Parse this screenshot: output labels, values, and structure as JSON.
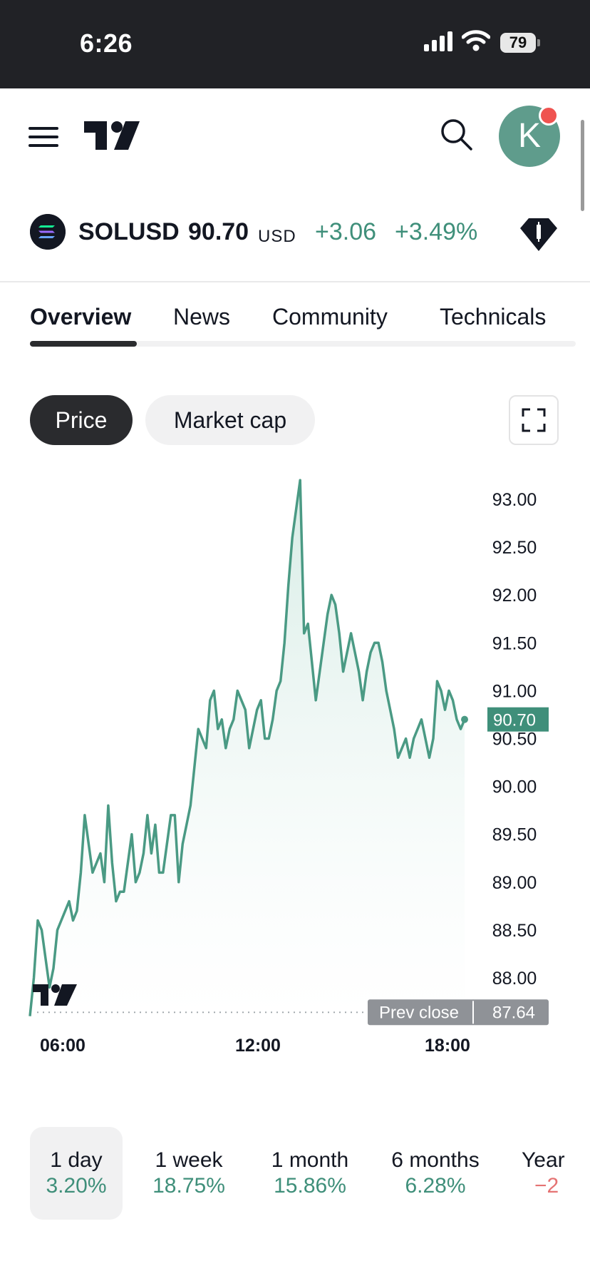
{
  "status_bar": {
    "time": "6:26",
    "battery": "79"
  },
  "header": {
    "avatar_letter": "K",
    "has_notification": true
  },
  "ticker": {
    "symbol": "SOLUSD",
    "price": "90.70",
    "currency": "USD",
    "change": "+3.06",
    "change_percent": "+3.49%",
    "change_color": "#3f8f7a"
  },
  "tabs": [
    {
      "label": "Overview",
      "active": true
    },
    {
      "label": "News",
      "active": false
    },
    {
      "label": "Community",
      "active": false
    },
    {
      "label": "Technicals",
      "active": false
    }
  ],
  "chart_toggle": {
    "price_label": "Price",
    "market_cap_label": "Market cap",
    "selected": "Price"
  },
  "chart_data": {
    "type": "area",
    "series_color": "#4a9a84",
    "y_ticks": [
      "93.00",
      "92.50",
      "92.00",
      "91.50",
      "91.00",
      "90.50",
      "90.00",
      "89.50",
      "89.00",
      "88.50",
      "88.00"
    ],
    "x_ticks": [
      "06:00",
      "12:00",
      "18:00"
    ],
    "ylim": [
      87.64,
      93.28
    ],
    "last_value": "90.70",
    "prev_close_label": "Prev close",
    "prev_close": "87.64",
    "values": [
      87.6,
      88.0,
      88.6,
      88.5,
      88.2,
      87.9,
      88.1,
      88.5,
      88.6,
      88.7,
      88.8,
      88.6,
      88.7,
      89.1,
      89.7,
      89.4,
      89.1,
      89.2,
      89.3,
      89.0,
      89.8,
      89.2,
      88.8,
      88.9,
      88.9,
      89.2,
      89.5,
      89.0,
      89.1,
      89.3,
      89.7,
      89.3,
      89.6,
      89.1,
      89.1,
      89.4,
      89.7,
      89.7,
      89.0,
      89.4,
      89.6,
      89.8,
      90.2,
      90.6,
      90.5,
      90.4,
      90.9,
      91.0,
      90.6,
      90.7,
      90.4,
      90.6,
      90.7,
      91.0,
      90.9,
      90.8,
      90.4,
      90.6,
      90.8,
      90.9,
      90.5,
      90.5,
      90.7,
      91.0,
      91.1,
      91.5,
      92.1,
      92.6,
      92.9,
      93.2,
      91.6,
      91.7,
      91.3,
      90.9,
      91.2,
      91.5,
      91.8,
      92.0,
      91.9,
      91.6,
      91.2,
      91.4,
      91.6,
      91.4,
      91.2,
      90.9,
      91.2,
      91.4,
      91.5,
      91.5,
      91.3,
      91.0,
      90.8,
      90.6,
      90.3,
      90.4,
      90.5,
      90.3,
      90.5,
      90.6,
      90.7,
      90.5,
      90.3,
      90.5,
      91.1,
      91.0,
      90.8,
      91.0,
      90.9,
      90.7,
      90.6,
      90.7
    ]
  },
  "ranges": [
    {
      "label": "1 day",
      "value": "3.20%",
      "color": "#3f8f7a",
      "selected": true
    },
    {
      "label": "1 week",
      "value": "18.75%",
      "color": "#3f8f7a",
      "selected": false
    },
    {
      "label": "1 month",
      "value": "15.86%",
      "color": "#3f8f7a",
      "selected": false
    },
    {
      "label": "6 months",
      "value": "6.28%",
      "color": "#3f8f7a",
      "selected": false
    },
    {
      "label": "Year",
      "value": "−2",
      "color": "#e57373",
      "selected": false
    }
  ]
}
